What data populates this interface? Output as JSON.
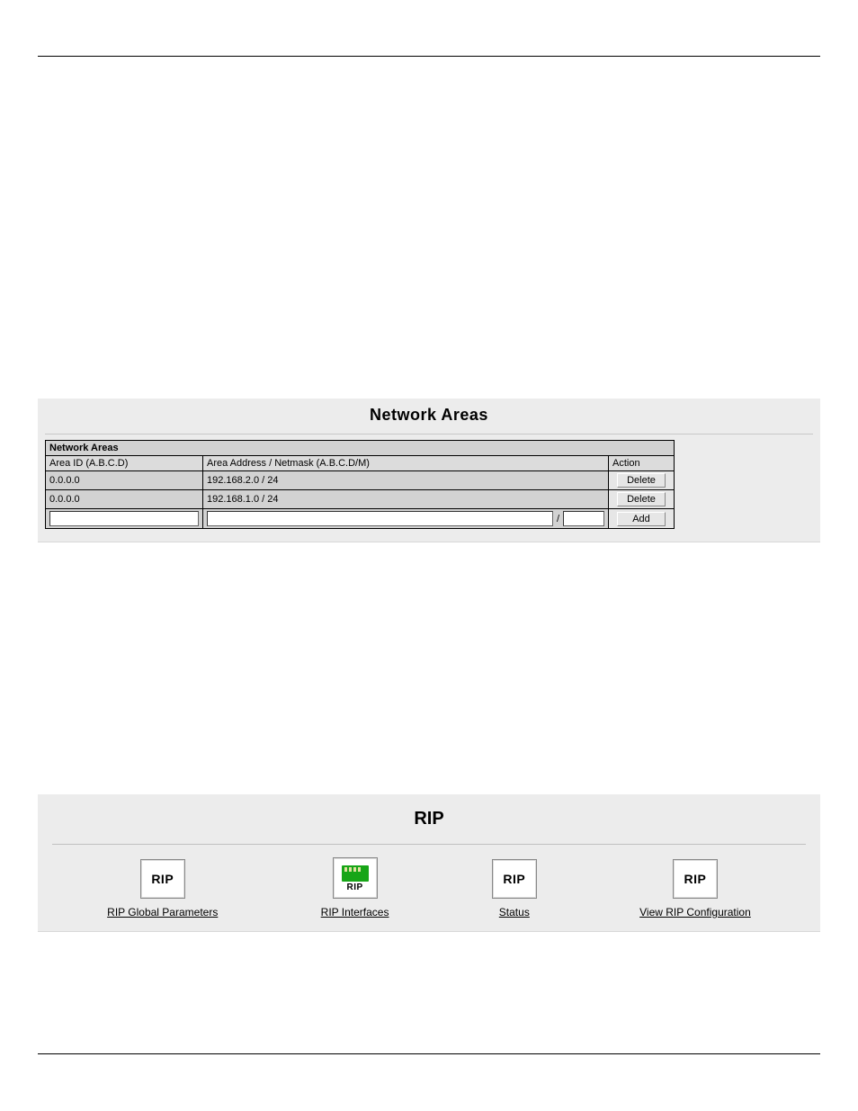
{
  "network_areas": {
    "title": "Network Areas",
    "table_caption": "Network Areas",
    "columns": {
      "area_id": "Area ID (A.B.C.D)",
      "addr": "Area Address / Netmask (A.B.C.D/M)",
      "action": "Action"
    },
    "rows": [
      {
        "area_id": "0.0.0.0",
        "addr": "192.168.2.0 / 24",
        "action_label": "Delete"
      },
      {
        "area_id": "0.0.0.0",
        "addr": "192.168.1.0 / 24",
        "action_label": "Delete"
      }
    ],
    "new_row": {
      "area_id_value": "",
      "addr_value": "",
      "slash_label": "/",
      "mask_value": "",
      "action_label": "Add"
    }
  },
  "rip": {
    "title": "RIP",
    "icon_label": "RIP",
    "links": {
      "global_parameters": "RIP Global Parameters",
      "interfaces": "RIP Interfaces",
      "status": "Status",
      "view_config": "View RIP Configuration"
    }
  }
}
